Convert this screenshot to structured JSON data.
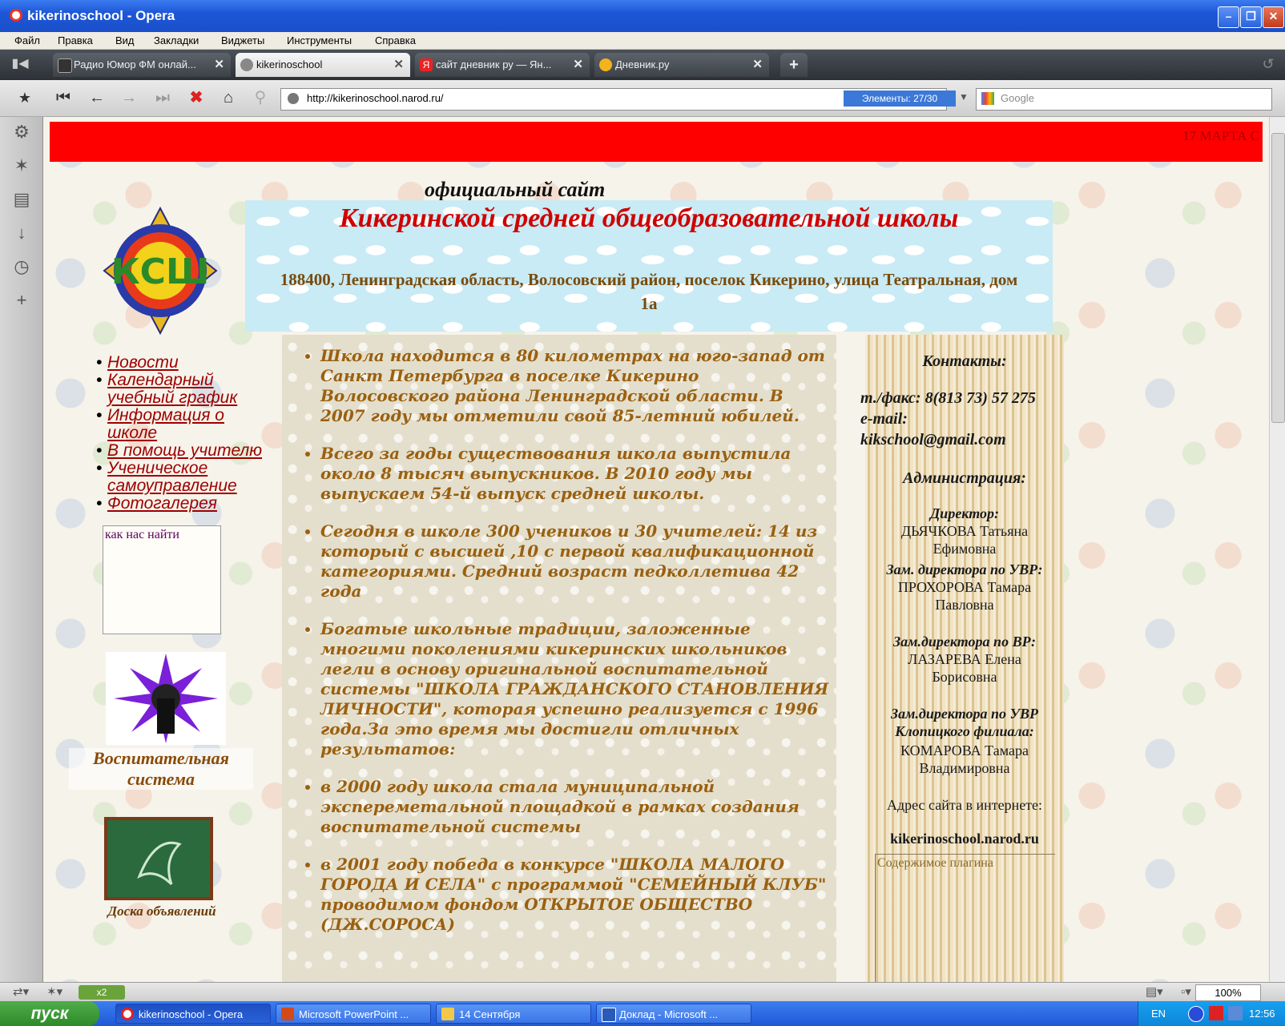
{
  "window": {
    "title": "kikerinoschool - Opera"
  },
  "menu": [
    "Файл",
    "Правка",
    "Вид",
    "Закладки",
    "Виджеты",
    "Инструменты",
    "Справка"
  ],
  "tabs": [
    {
      "label": "Радио Юмор ФМ онлай..."
    },
    {
      "label": "kikerinoschool"
    },
    {
      "label": "сайт дневник ру — Ян..."
    },
    {
      "label": "Дневник.ру"
    }
  ],
  "address": {
    "url": "http://kikerinoschool.narod.ru/",
    "elements": "Элементы: 27/30"
  },
  "search": {
    "placeholder": "Google"
  },
  "page": {
    "marquee": "17 МАРТА С",
    "official": "официальный сайт",
    "school_name": "Кикеринской средней общеобразовательной школы",
    "address": "188400, Ленинградская область, Волосовский район, поселок Кикерино, улица Театральная, дом 1а",
    "nav": [
      "Новости",
      "Календарный учебный график",
      "Информация о школе",
      "В помощь учителю",
      "Ученическое самоуправление",
      "Фотогалерея"
    ],
    "find_us": "как нас найти",
    "vos_label": "Воспитательная система",
    "board_label": "Доска объявлений",
    "paragraphs": [
      "Школа находится в 80 километрах на юго-запад от Санкт Петербурга в поселке Кикерино Волосовского района Ленинградской области. В 2007 году мы отметили свой 85-летний юбилей.",
      "Всего за годы существования школа выпустила около 8 тысяч выпускников. В 2010 году мы выпускаем 54-й выпуск средней школы.",
      "Сегодня в школе 300 учеников и 30 учителей: 14 из который с высшей ,10 с первой квалификационной категориями. Средний возраст педколлетива 42 года",
      "Богатые школьные традиции, заложенные многими поколениями кикеринских школьников легли в основу оригинальной воспитательной системы \"ШКОЛА ГРАЖДАНСКОГО СТАНОВЛЕНИЯ ЛИЧНОСТИ\", которая успешно реализуется с 1996 года.За это время мы достигли отличных результатов:",
      "в 2000 году школа стала муниципальной экспереметальной площадкой в рамках создания воспитательной системы",
      "в 2001 году победа в конкурсе \"ШКОЛА МАЛОГО ГОРОДА И СЕЛА\" с программой \"СЕМЕЙНЫЙ КЛУБ\" проводимом фондом ОТКРЫТОЕ ОБЩЕСТВО (ДЖ.СОРОСА)"
    ],
    "contacts": {
      "title": "Контакты:",
      "phone": "т./факс: 8(813 73) 57 275",
      "email_label": "e-mail:",
      "email": "kikschool@gmail.com",
      "admin_title": "Администрация:",
      "director_role": "Директор:",
      "director_name": "ДЬЯЧКОВА Татьяна Ефимовна",
      "zam1_role": "Зам. директора по УВР:",
      "zam1_name": "ПРОХОРОВА Тамара Павловна",
      "zam2_role": "Зам.директора по ВР:",
      "zam2_name": "ЛАЗАРЕВА Елена Борисовна",
      "zam3_role": "Зам.директора по УВР Клопицкого филиала:",
      "zam3_name": "КОМАРОВА Тамара Владимировна",
      "site_label": "Адрес сайта в интернете:",
      "site": "kikerinoschool.narod.ru",
      "plugin": "Содержимое плагина"
    }
  },
  "status": {
    "turbo": "x2",
    "zoom": "100%"
  },
  "taskbar": {
    "start": "пуск",
    "items": [
      "kikerinoschool - Opera",
      "Microsoft PowerPoint ...",
      "14 Сентября",
      "Доклад - Microsoft ..."
    ],
    "lang": "EN",
    "time": "12:56"
  }
}
